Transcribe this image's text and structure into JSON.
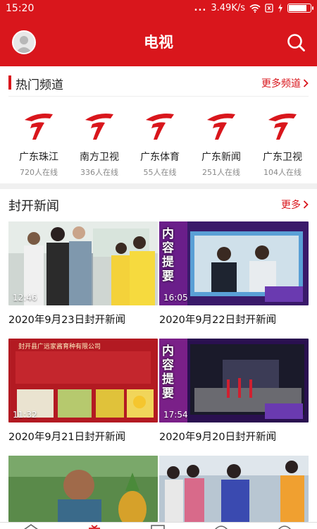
{
  "status_bar": {
    "time": "15:20",
    "signal_dots": "...",
    "speed": "3.49K/s",
    "icons": [
      "wifi-icon",
      "sim-icon",
      "charging-icon",
      "battery-icon"
    ],
    "battery_level": 0.85
  },
  "header": {
    "title": "电视",
    "avatar_icon": "avatar-icon",
    "search_icon": "search-icon"
  },
  "hot_channels": {
    "title": "热门频道",
    "more_label": "更多频道",
    "items": [
      {
        "name": "广东珠江",
        "online": "720人在线"
      },
      {
        "name": "南方卫视",
        "online": "336人在线"
      },
      {
        "name": "广东体育",
        "online": "55人在线"
      },
      {
        "name": "广东新闻",
        "online": "251人在线"
      },
      {
        "name": "广东卫视",
        "online": "104人在线"
      }
    ]
  },
  "news": {
    "title": "封开新闻",
    "more_label": "更多",
    "items": [
      {
        "title": "2020年9月23日封开新闻",
        "duration": "12:46"
      },
      {
        "title": "2020年9月22日封开新闻",
        "duration": "16:05",
        "overlay_text": "内容提要"
      },
      {
        "title": "2020年9月21日封开新闻",
        "duration": "11:32",
        "overlay_text": "封开县广远家酱育种有限公司"
      },
      {
        "title": "2020年9月20日封开新闻",
        "duration": "17:54",
        "overlay_text": "内容提要"
      },
      {
        "title": "",
        "duration": ""
      },
      {
        "title": "",
        "duration": ""
      }
    ]
  },
  "colors": {
    "brand": "#d9161c",
    "divider": "#f0f0f0"
  }
}
